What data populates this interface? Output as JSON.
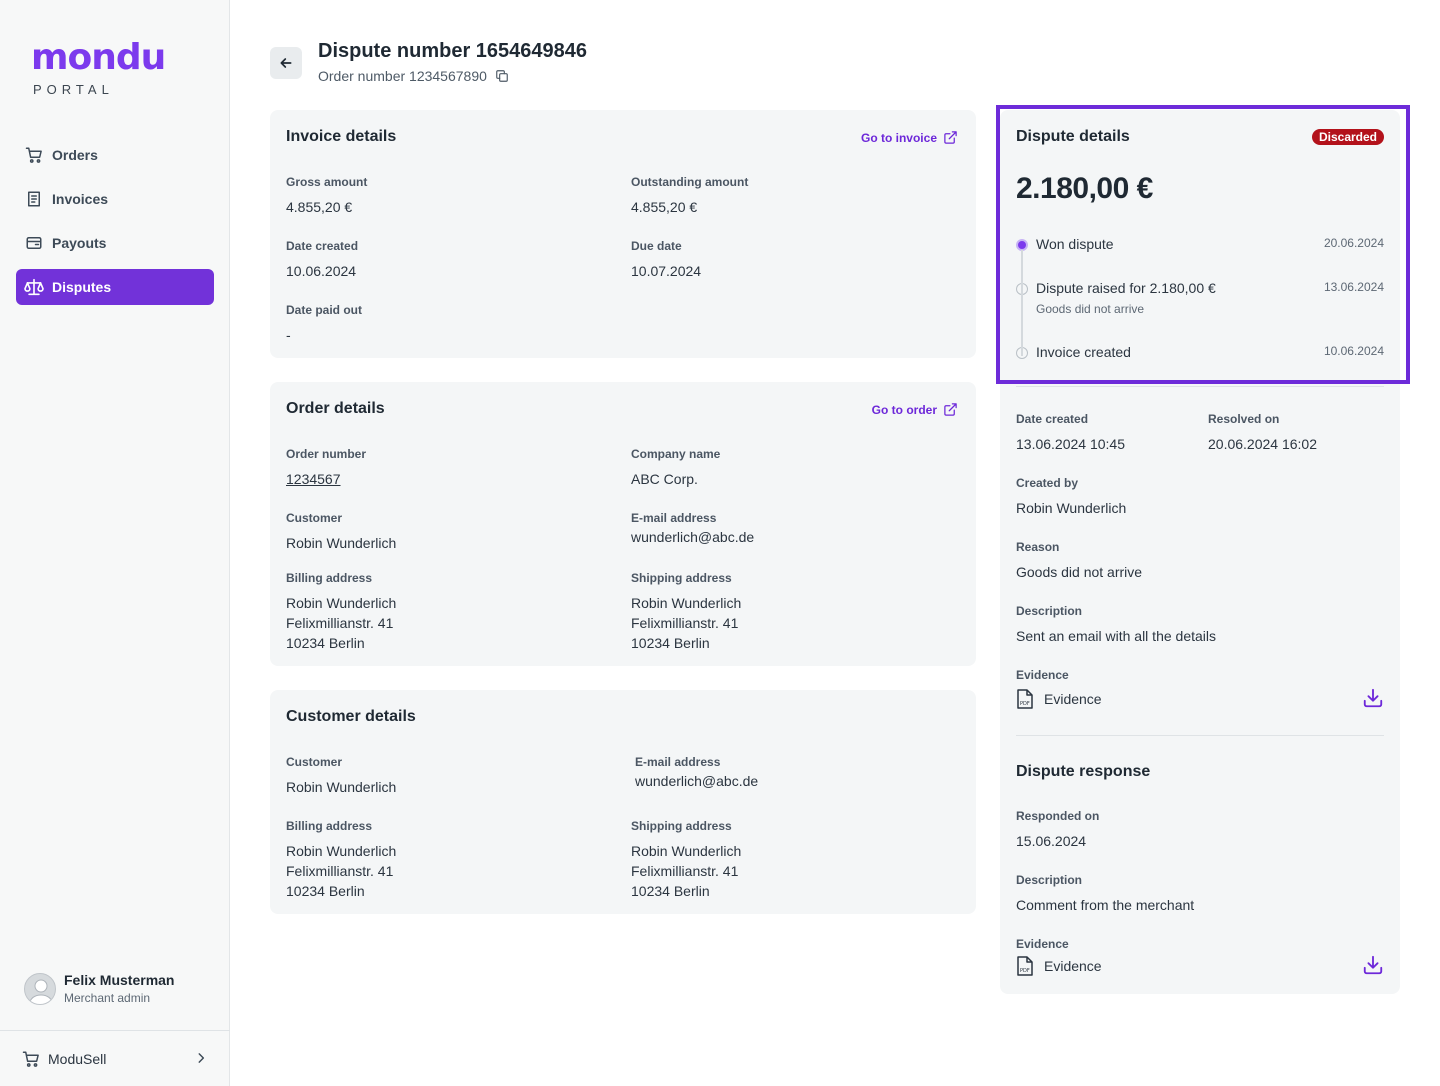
{
  "sidebar": {
    "logo_word": "mondu",
    "logo_sub": "PORTAL",
    "nav": [
      {
        "label": "Orders",
        "icon": "cart-icon"
      },
      {
        "label": "Invoices",
        "icon": "invoice-icon"
      },
      {
        "label": "Payouts",
        "icon": "wallet-icon"
      },
      {
        "label": "Disputes",
        "icon": "scale-icon",
        "active": true
      }
    ],
    "user": {
      "name": "Felix Musterman",
      "role": "Merchant admin"
    },
    "mondusell": "ModuSell"
  },
  "header": {
    "title": "Dispute number 1654649846",
    "subtitle": "Order number 1234567890"
  },
  "invoice": {
    "title": "Invoice details",
    "link": "Go to invoice",
    "gross_label": "Gross amount",
    "gross_value": "4.855,20 €",
    "outstanding_label": "Outstanding amount",
    "outstanding_value": "4.855,20 €",
    "created_label": "Date created",
    "created_value": "10.06.2024",
    "due_label": "Due date",
    "due_value": "10.07.2024",
    "paid_label": "Date paid out",
    "paid_value": "-"
  },
  "order": {
    "title": "Order details",
    "link": "Go to order",
    "number_label": "Order number",
    "number_value": "1234567",
    "company_label": "Company name",
    "company_value": "ABC Corp.",
    "customer_label": "Customer",
    "customer_value": "Robin Wunderlich",
    "email_label": "E-mail address",
    "email_value": "wunderlich@abc.de",
    "billing_label": "Billing address",
    "billing_lines": [
      "Robin Wunderlich",
      "Felixmillianstr. 41",
      "10234 Berlin"
    ],
    "shipping_label": "Shipping address",
    "shipping_lines": [
      "Robin Wunderlich",
      "Felixmillianstr. 41",
      "10234 Berlin"
    ]
  },
  "customer": {
    "title": "Customer details",
    "customer_label": "Customer",
    "customer_value": "Robin Wunderlich",
    "email_label": "E-mail address",
    "email_value": "wunderlich@abc.de",
    "billing_label": "Billing address",
    "billing_lines": [
      "Robin Wunderlich",
      "Felixmillianstr. 41",
      "10234 Berlin"
    ],
    "shipping_label": "Shipping address",
    "shipping_lines": [
      "Robin Wunderlich",
      "Felixmillianstr. 41",
      "10234 Berlin"
    ]
  },
  "dispute": {
    "title": "Dispute details",
    "status": "Discarded",
    "amount": "2.180,00 €",
    "timeline": [
      {
        "label": "Won dispute",
        "date": "20.06.2024",
        "sub": "",
        "active": true
      },
      {
        "label": "Dispute raised for 2.180,00 €",
        "date": "13.06.2024",
        "sub": "Goods did not arrive",
        "active": false
      },
      {
        "label": "Invoice created",
        "date": "10.06.2024",
        "sub": "",
        "active": false
      }
    ],
    "created_label": "Date created",
    "created_value": "13.06.2024 10:45",
    "resolved_label": "Resolved on",
    "resolved_value": "20.06.2024 16:02",
    "created_by_label": "Created by",
    "created_by_value": "Robin Wunderlich",
    "reason_label": "Reason",
    "reason_value": "Goods did not arrive",
    "description_label": "Description",
    "description_value": "Sent an email with all the details",
    "evidence_label": "Evidence",
    "evidence_file": "Evidence"
  },
  "response": {
    "title": "Dispute response",
    "responded_label": "Responded on",
    "responded_value": "15.06.2024",
    "description_label": "Description",
    "description_value": "Comment from the merchant",
    "evidence_label": "Evidence",
    "evidence_file": "Evidence"
  },
  "colors": {
    "accent": "#7232d9",
    "badge": "#b3121b",
    "card_bg": "#f4f6f7"
  }
}
